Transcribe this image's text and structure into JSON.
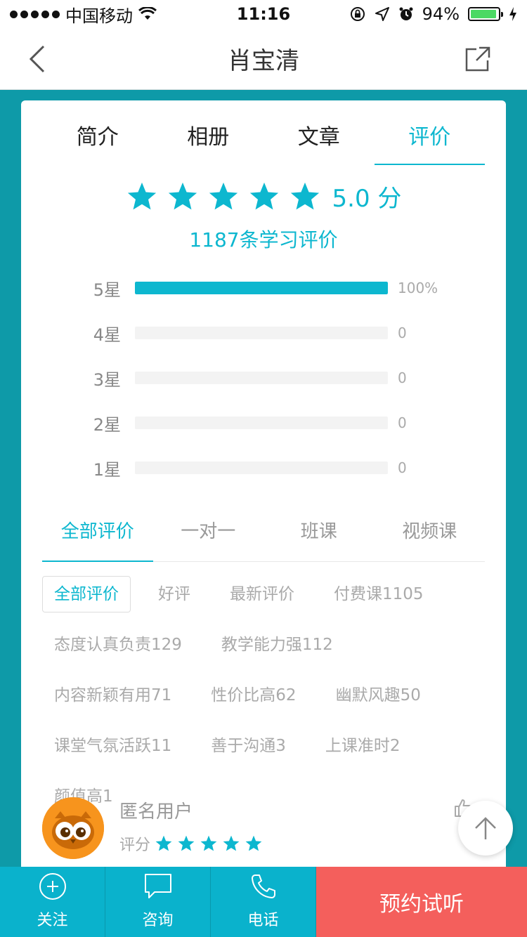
{
  "status_bar": {
    "carrier": "中国移动",
    "time": "11:16",
    "battery": "94%",
    "battery_level": 0.94
  },
  "nav": {
    "title": "肖宝清"
  },
  "tabs": [
    "简介",
    "相册",
    "文章",
    "评价"
  ],
  "rating": {
    "stars": 5,
    "score_text": "5.0 分",
    "count_text": "1187条学习评价"
  },
  "distribution": [
    {
      "label": "5星",
      "value_text": "100%",
      "fraction": 1.0
    },
    {
      "label": "4星",
      "value_text": "0",
      "fraction": 0
    },
    {
      "label": "3星",
      "value_text": "0",
      "fraction": 0
    },
    {
      "label": "2星",
      "value_text": "0",
      "fraction": 0
    },
    {
      "label": "1星",
      "value_text": "0",
      "fraction": 0
    }
  ],
  "sub_tabs": [
    "全部评价",
    "一对一",
    "班课",
    "视频课"
  ],
  "tags": [
    "全部评价",
    "好评",
    "最新评价",
    "付费课1105",
    "态度认真负责129",
    "教学能力强112",
    "内容新颖有用71",
    "性价比高62",
    "幽默风趣50",
    "课堂气氛活跃11",
    "善于沟通3",
    "上课准时2",
    "颜值高1"
  ],
  "review": {
    "name": "匿名用户",
    "rating_label": "评分",
    "stars": 5
  },
  "bottom_bar": {
    "follow": "关注",
    "consult": "咨询",
    "phone": "电话",
    "book": "预约试听"
  },
  "colors": {
    "accent": "#0db7cf",
    "teal_bg": "#0e9aa8",
    "book": "#f45f5c",
    "avatar": "#f7941d"
  }
}
